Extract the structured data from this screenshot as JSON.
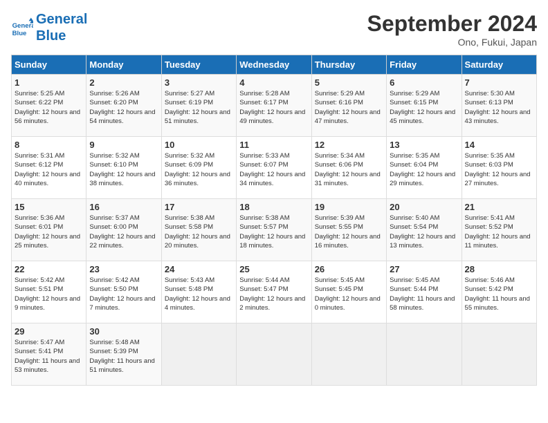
{
  "header": {
    "logo_line1": "General",
    "logo_line2": "Blue",
    "title": "September 2024",
    "location": "Ono, Fukui, Japan"
  },
  "days_of_week": [
    "Sunday",
    "Monday",
    "Tuesday",
    "Wednesday",
    "Thursday",
    "Friday",
    "Saturday"
  ],
  "weeks": [
    [
      {
        "day": "1",
        "detail": "Sunrise: 5:25 AM\nSunset: 6:22 PM\nDaylight: 12 hours\nand 56 minutes."
      },
      {
        "day": "2",
        "detail": "Sunrise: 5:26 AM\nSunset: 6:20 PM\nDaylight: 12 hours\nand 54 minutes."
      },
      {
        "day": "3",
        "detail": "Sunrise: 5:27 AM\nSunset: 6:19 PM\nDaylight: 12 hours\nand 51 minutes."
      },
      {
        "day": "4",
        "detail": "Sunrise: 5:28 AM\nSunset: 6:17 PM\nDaylight: 12 hours\nand 49 minutes."
      },
      {
        "day": "5",
        "detail": "Sunrise: 5:29 AM\nSunset: 6:16 PM\nDaylight: 12 hours\nand 47 minutes."
      },
      {
        "day": "6",
        "detail": "Sunrise: 5:29 AM\nSunset: 6:15 PM\nDaylight: 12 hours\nand 45 minutes."
      },
      {
        "day": "7",
        "detail": "Sunrise: 5:30 AM\nSunset: 6:13 PM\nDaylight: 12 hours\nand 43 minutes."
      }
    ],
    [
      {
        "day": "8",
        "detail": "Sunrise: 5:31 AM\nSunset: 6:12 PM\nDaylight: 12 hours\nand 40 minutes."
      },
      {
        "day": "9",
        "detail": "Sunrise: 5:32 AM\nSunset: 6:10 PM\nDaylight: 12 hours\nand 38 minutes."
      },
      {
        "day": "10",
        "detail": "Sunrise: 5:32 AM\nSunset: 6:09 PM\nDaylight: 12 hours\nand 36 minutes."
      },
      {
        "day": "11",
        "detail": "Sunrise: 5:33 AM\nSunset: 6:07 PM\nDaylight: 12 hours\nand 34 minutes."
      },
      {
        "day": "12",
        "detail": "Sunrise: 5:34 AM\nSunset: 6:06 PM\nDaylight: 12 hours\nand 31 minutes."
      },
      {
        "day": "13",
        "detail": "Sunrise: 5:35 AM\nSunset: 6:04 PM\nDaylight: 12 hours\nand 29 minutes."
      },
      {
        "day": "14",
        "detail": "Sunrise: 5:35 AM\nSunset: 6:03 PM\nDaylight: 12 hours\nand 27 minutes."
      }
    ],
    [
      {
        "day": "15",
        "detail": "Sunrise: 5:36 AM\nSunset: 6:01 PM\nDaylight: 12 hours\nand 25 minutes."
      },
      {
        "day": "16",
        "detail": "Sunrise: 5:37 AM\nSunset: 6:00 PM\nDaylight: 12 hours\nand 22 minutes."
      },
      {
        "day": "17",
        "detail": "Sunrise: 5:38 AM\nSunset: 5:58 PM\nDaylight: 12 hours\nand 20 minutes."
      },
      {
        "day": "18",
        "detail": "Sunrise: 5:38 AM\nSunset: 5:57 PM\nDaylight: 12 hours\nand 18 minutes."
      },
      {
        "day": "19",
        "detail": "Sunrise: 5:39 AM\nSunset: 5:55 PM\nDaylight: 12 hours\nand 16 minutes."
      },
      {
        "day": "20",
        "detail": "Sunrise: 5:40 AM\nSunset: 5:54 PM\nDaylight: 12 hours\nand 13 minutes."
      },
      {
        "day": "21",
        "detail": "Sunrise: 5:41 AM\nSunset: 5:52 PM\nDaylight: 12 hours\nand 11 minutes."
      }
    ],
    [
      {
        "day": "22",
        "detail": "Sunrise: 5:42 AM\nSunset: 5:51 PM\nDaylight: 12 hours\nand 9 minutes."
      },
      {
        "day": "23",
        "detail": "Sunrise: 5:42 AM\nSunset: 5:50 PM\nDaylight: 12 hours\nand 7 minutes."
      },
      {
        "day": "24",
        "detail": "Sunrise: 5:43 AM\nSunset: 5:48 PM\nDaylight: 12 hours\nand 4 minutes."
      },
      {
        "day": "25",
        "detail": "Sunrise: 5:44 AM\nSunset: 5:47 PM\nDaylight: 12 hours\nand 2 minutes."
      },
      {
        "day": "26",
        "detail": "Sunrise: 5:45 AM\nSunset: 5:45 PM\nDaylight: 12 hours\nand 0 minutes."
      },
      {
        "day": "27",
        "detail": "Sunrise: 5:45 AM\nSunset: 5:44 PM\nDaylight: 11 hours\nand 58 minutes."
      },
      {
        "day": "28",
        "detail": "Sunrise: 5:46 AM\nSunset: 5:42 PM\nDaylight: 11 hours\nand 55 minutes."
      }
    ],
    [
      {
        "day": "29",
        "detail": "Sunrise: 5:47 AM\nSunset: 5:41 PM\nDaylight: 11 hours\nand 53 minutes."
      },
      {
        "day": "30",
        "detail": "Sunrise: 5:48 AM\nSunset: 5:39 PM\nDaylight: 11 hours\nand 51 minutes."
      },
      null,
      null,
      null,
      null,
      null
    ]
  ]
}
